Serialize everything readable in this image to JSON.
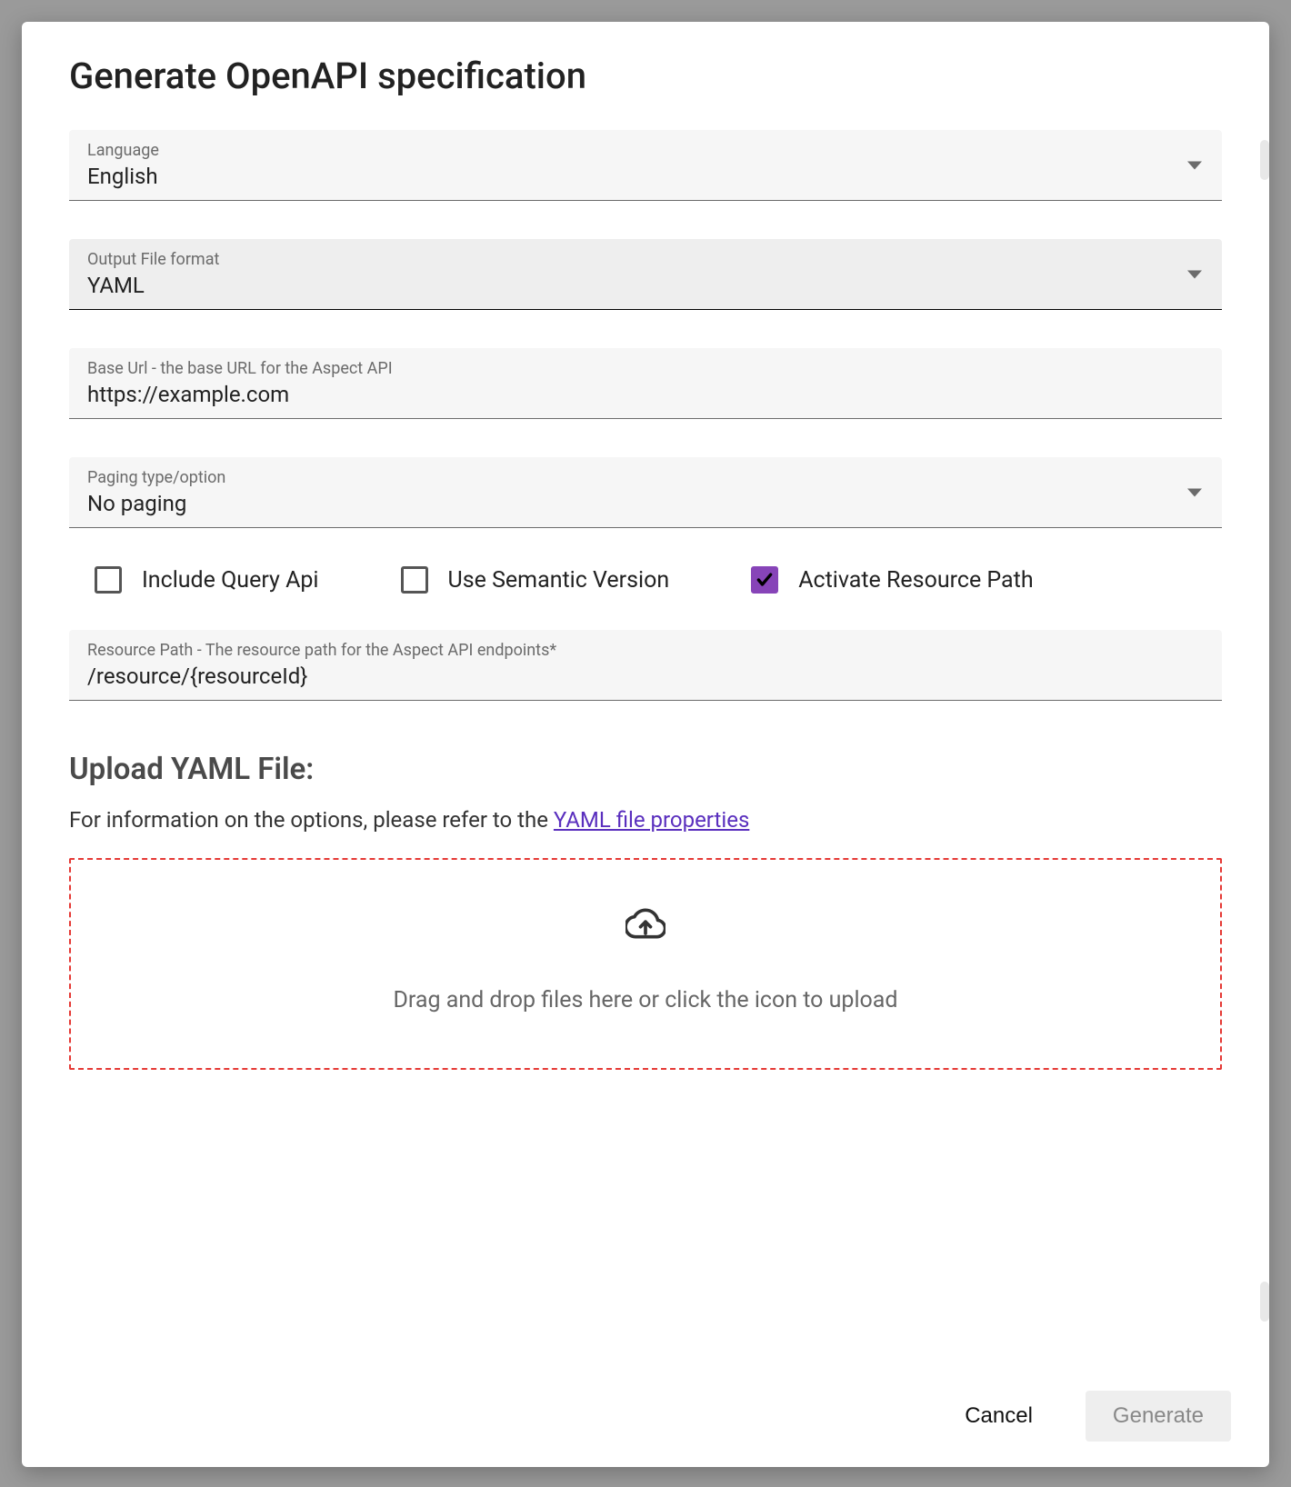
{
  "dialog": {
    "title": "Generate OpenAPI specification"
  },
  "fields": {
    "language": {
      "label": "Language",
      "value": "English"
    },
    "outputFormat": {
      "label": "Output File format",
      "value": "YAML"
    },
    "baseUrl": {
      "label": "Base Url - the base URL for the Aspect API",
      "value": "https://example.com"
    },
    "paging": {
      "label": "Paging type/option",
      "value": "No paging"
    },
    "resourcePath": {
      "label": "Resource Path - The resource path for the Aspect API endpoints*",
      "value": "/resource/{resourceId}"
    }
  },
  "checkboxes": {
    "includeQueryApi": {
      "label": "Include Query Api",
      "checked": false
    },
    "useSemanticVersion": {
      "label": "Use Semantic Version",
      "checked": false
    },
    "activateResourcePath": {
      "label": "Activate Resource Path",
      "checked": true
    }
  },
  "upload": {
    "sectionTitle": "Upload YAML File:",
    "helpPrefix": "For information on the options, please refer to the ",
    "helpLinkText": "YAML file properties",
    "dropText": "Drag and drop files here or click the icon to upload"
  },
  "actions": {
    "cancel": "Cancel",
    "generate": "Generate"
  },
  "colors": {
    "accent": "#8744b8",
    "link": "#5a2fbe",
    "dropBorder": "#e53935"
  }
}
